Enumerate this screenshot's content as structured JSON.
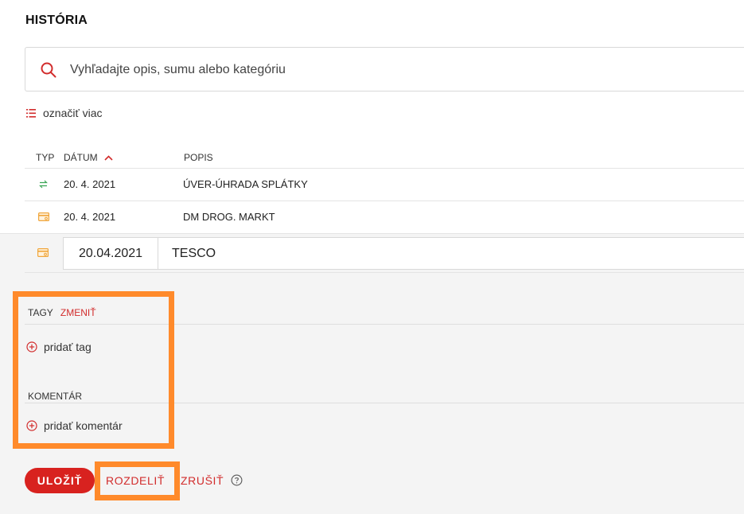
{
  "page": {
    "title": "HISTÓRIA"
  },
  "search": {
    "placeholder": "Vyhľadajte opis, sumu alebo kategóriu"
  },
  "toolbar": {
    "mark_more": "označiť viac"
  },
  "table": {
    "headers": {
      "type": "TYP",
      "date": "DÁTUM",
      "description": "POPIS"
    },
    "rows": [
      {
        "type_icon": "transfer-icon",
        "date": "20. 4. 2021",
        "description": "ÚVER-ÚHRADA SPLÁTKY"
      },
      {
        "type_icon": "card-payment-icon",
        "date": "20. 4. 2021",
        "description": "DM DROG. MARKT"
      }
    ]
  },
  "edit": {
    "type_icon": "card-payment-icon",
    "date_value": "20.04.2021",
    "description_value": "TESCO",
    "tags_label": "TAGY",
    "tags_change": "ZMENIŤ",
    "add_tag": "pridať tag",
    "comment_label": "KOMENTÁR",
    "add_comment": "pridať komentár"
  },
  "actions": {
    "save": "ULOŽIŤ",
    "split": "ROZDELIŤ",
    "cancel": "ZRUŠIŤ",
    "help_icon": "help-icon"
  },
  "colors": {
    "accent_red": "#d22c2c",
    "highlight_orange": "#ff8a2b",
    "transfer_green": "#3aa655",
    "card_orange": "#f0a53a",
    "edit_background": "#f4f4f4"
  }
}
